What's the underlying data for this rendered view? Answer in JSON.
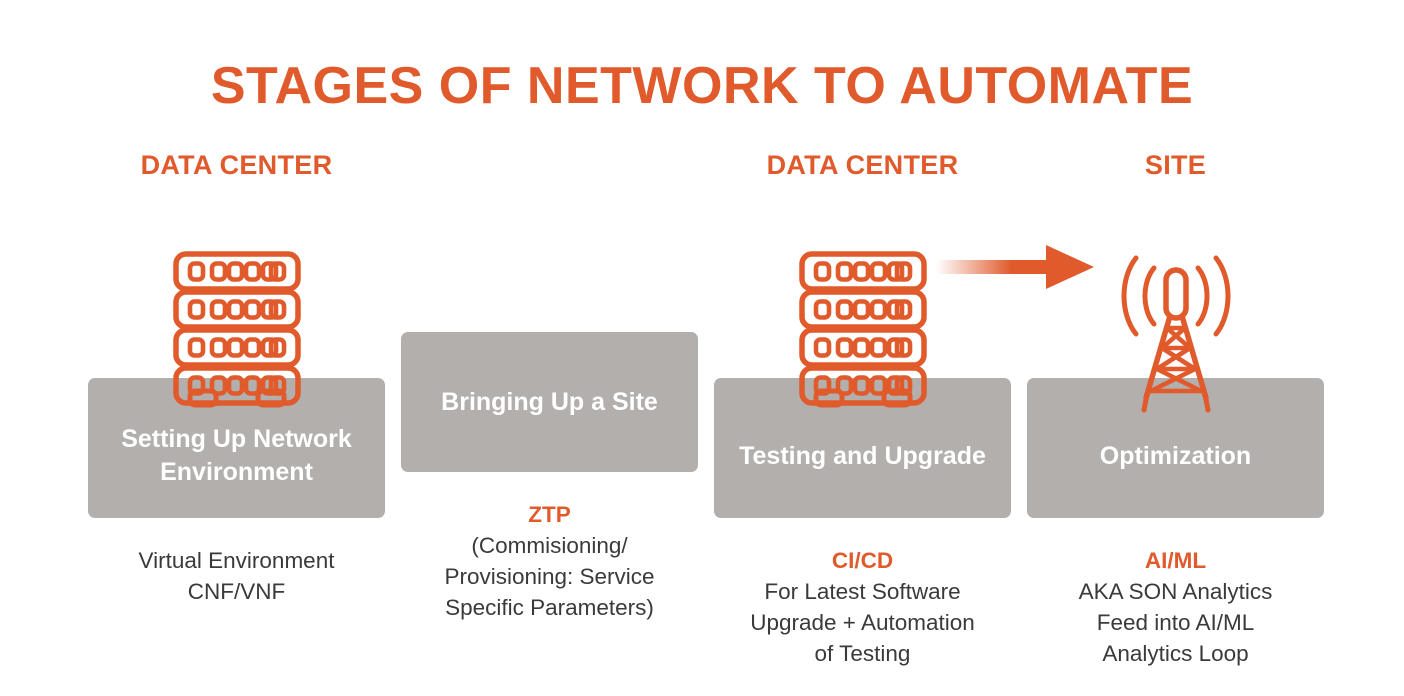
{
  "theme": {
    "accent": "#E05A2B",
    "card_bg": "#B2AFAC",
    "card_text": "#FFFFFF",
    "caption_text": "#3A3A3A",
    "page_bg": "#FFFFFF"
  },
  "title": "STAGES OF NETWORK TO AUTOMATE",
  "arrow": {
    "icon": "right-arrow-icon",
    "from": "DATA CENTER",
    "to": "SITE"
  },
  "stages": [
    {
      "header": "DATA CENTER",
      "icon": "server-rack-icon",
      "card_label": "Setting Up Network Environment",
      "caption_head": "",
      "caption_body": "Virtual Environment\nCNF/VNF"
    },
    {
      "header": "",
      "icon": "",
      "card_label": "Bringing Up a Site",
      "caption_head": "ZTP",
      "caption_body": "(Commisioning/\nProvisioning: Service\nSpecific Parameters)"
    },
    {
      "header": "DATA CENTER",
      "icon": "server-rack-icon",
      "card_label": "Testing and Upgrade",
      "caption_head": "CI/CD",
      "caption_body": "For Latest Software\nUpgrade + Automation\nof Testing"
    },
    {
      "header": "SITE",
      "icon": "cell-tower-icon",
      "card_label": "Optimization",
      "caption_head": "AI/ML",
      "caption_body": "AKA SON Analytics\nFeed into AI/ML\nAnalytics Loop"
    }
  ]
}
